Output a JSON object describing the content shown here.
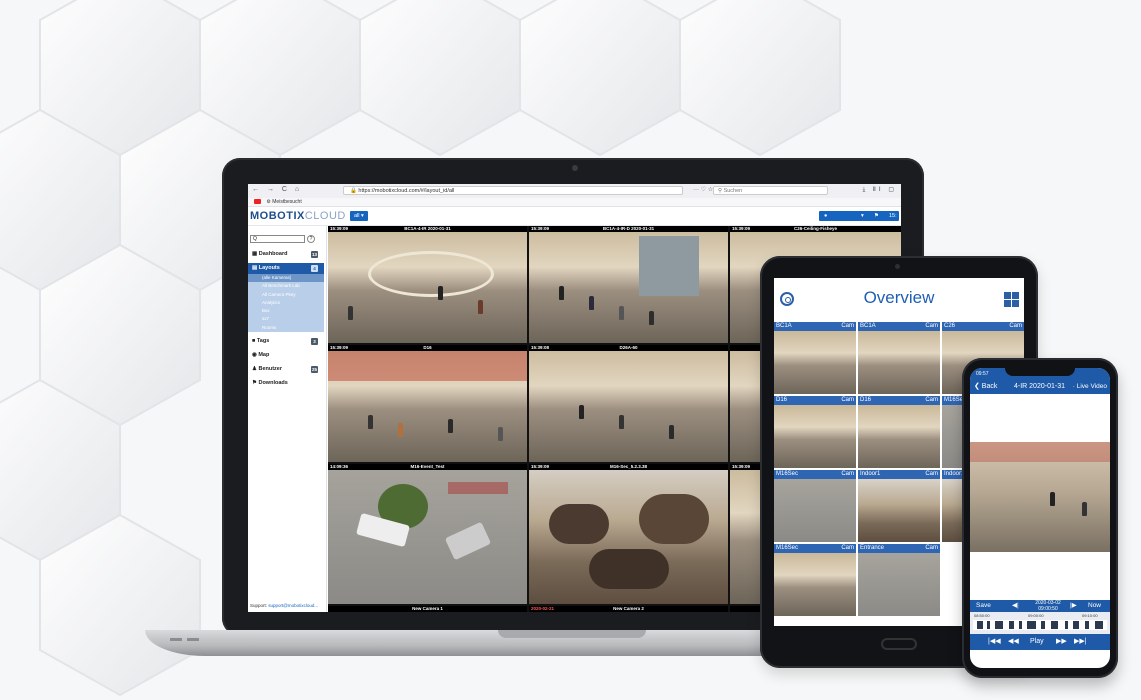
{
  "browser": {
    "nav_glyphs": "← → C ⌂",
    "url": "https://mobotixcloud.com/#/layout_id/all",
    "url_actions": "··· ♡ ☆",
    "search_placeholder": "Suchen",
    "right_icons": "⤓ ⅡⅠ ▢",
    "bookmark": "Meistbesucht"
  },
  "app": {
    "logo_bold": "MOBOTIX",
    "logo_light": "CLOUD",
    "filter_button": "all ▾",
    "user_caret": "▾",
    "user_time": "15:"
  },
  "sidebar": {
    "search_placeholder": "Q",
    "help": "?",
    "items": [
      {
        "label": "Dashboard",
        "count": "13"
      },
      {
        "label": "Layouts",
        "count": "4"
      },
      {
        "label": "Tags",
        "count": "3"
      },
      {
        "label": "Map",
        "count": ""
      },
      {
        "label": "Benutzer",
        "count": "25"
      },
      {
        "label": "Downloads",
        "count": ""
      }
    ],
    "layouts_sub": [
      "(alle Kameras)",
      "All Benchmark Lab",
      "All Camera Pkey",
      "Analytics",
      "Bxx",
      "sx7",
      "Rooms"
    ],
    "support_label": "Support:",
    "support_email": "support@mobotixcloud..."
  },
  "cameras": [
    {
      "time": "15:39:09",
      "name": "BC1A-4-IR 2020-01-31"
    },
    {
      "time": "15:39:09",
      "name": "BC1A-4-IR-D 2020-01-31"
    },
    {
      "time": "15:39:09",
      "name": "C26-Ceiling-Fisheye"
    },
    {
      "time": "15:39:09",
      "name": "D16"
    },
    {
      "time": "15:39:08",
      "name": "D26A-60"
    },
    {
      "time": "",
      "name": ""
    },
    {
      "time": "14:09:36",
      "name": "M16-Event_Test"
    },
    {
      "time": "15:39:09",
      "name": "M16-Sec_5.2.3.38"
    },
    {
      "time": "15:39:09",
      "name": ""
    }
  ],
  "camera_footer": [
    {
      "red": "",
      "name": "New Camera 1"
    },
    {
      "red": "2020-02-21",
      "name": "New Camera 2"
    },
    {
      "red": "",
      "name": ""
    }
  ],
  "tablet": {
    "title": "Overview",
    "tiles": [
      {
        "name": "BC1A",
        "type": "Cam"
      },
      {
        "name": "BC1A",
        "type": "Cam"
      },
      {
        "name": "C26",
        "type": "Cam"
      },
      {
        "name": "D16",
        "type": "Cam"
      },
      {
        "name": "D16",
        "type": "Cam"
      },
      {
        "name": "M16Sec",
        "type": ""
      },
      {
        "name": "M16Sec",
        "type": "Cam"
      },
      {
        "name": "Indoor1",
        "type": "Cam"
      },
      {
        "name": "Indoor1",
        "type": ""
      },
      {
        "name": "M16Sec",
        "type": "Cam"
      },
      {
        "name": "Entrance",
        "type": "Cam"
      }
    ]
  },
  "phone": {
    "status_time": "09:57",
    "back": "❮ Back",
    "title": "4-IR 2020-01-31",
    "live": "· Live Video",
    "controls": {
      "save": "Save",
      "prev": "◀|",
      "datetime": "2020-03-02 09:00:50",
      "next": "|▶",
      "now": "Now"
    },
    "timeline_labels": [
      "08:50:00",
      "09:00:00",
      "09:10:00"
    ],
    "playbar": {
      "first": "|◀◀",
      "rew": "◀◀",
      "play": "Play",
      "ff": "▶▶",
      "last": "▶▶|"
    }
  },
  "colors": {
    "accent": "#1e5aa8",
    "brand": "#1e4e8c",
    "alert": "#ff5a5a"
  }
}
